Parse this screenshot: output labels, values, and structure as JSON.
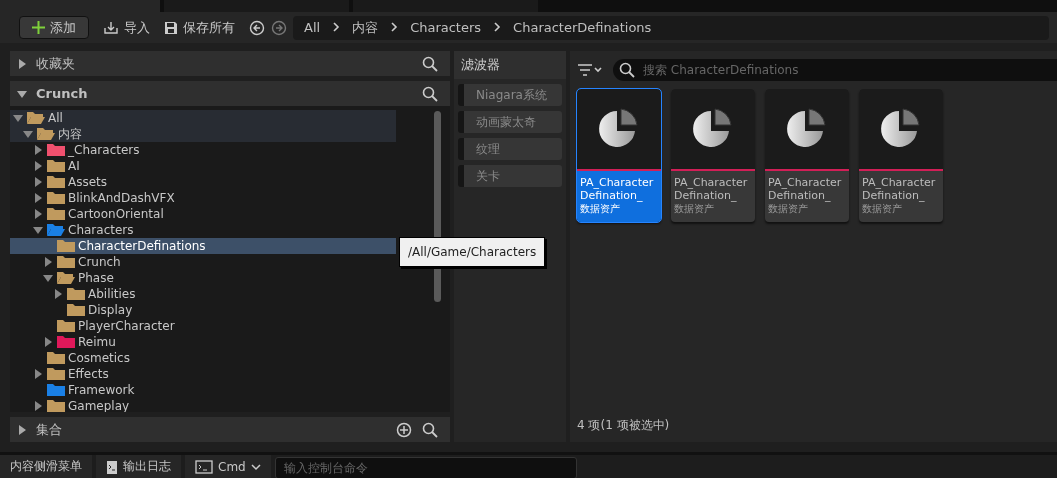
{
  "tabs": [
    {
      "selected": true
    },
    {
      "selected": false
    },
    {
      "selected": false
    }
  ],
  "toolbar": {
    "add": "添加",
    "import": "导入",
    "save_all": "保存所有"
  },
  "breadcrumb": [
    "All",
    "内容",
    "Characters",
    "CharacterDefinations"
  ],
  "favorites": {
    "title": "收藏夹",
    "expanded": false
  },
  "project": {
    "title": "Crunch",
    "expanded": true
  },
  "tree": [
    {
      "label": "All",
      "expanded": true,
      "selected": false,
      "color": "#c09a5e",
      "children": [
        {
          "label": "内容",
          "expanded": true,
          "selected": false,
          "color": "#c09a5e",
          "children": [
            {
              "label": "_Characters",
              "expanded": false,
              "selected": false,
              "color": "#f0506e"
            },
            {
              "label": "AI",
              "expanded": false,
              "selected": false,
              "color": "#c09a5e"
            },
            {
              "label": "Assets",
              "expanded": false,
              "selected": false,
              "color": "#c09a5e"
            },
            {
              "label": "BlinkAndDashVFX",
              "expanded": false,
              "selected": false,
              "color": "#c09a5e"
            },
            {
              "label": "CartoonOriental",
              "expanded": false,
              "selected": false,
              "color": "#c09a5e"
            },
            {
              "label": "Characters",
              "expanded": true,
              "selected": false,
              "color": "#1a80e6",
              "children": [
                {
                  "label": "CharacterDefinations",
                  "selected": true,
                  "color": "#c09a5e"
                },
                {
                  "label": "Crunch",
                  "expanded": false,
                  "selected": false,
                  "color": "#c09a5e"
                },
                {
                  "label": "Phase",
                  "expanded": true,
                  "selected": false,
                  "color": "#c09a5e",
                  "children": [
                    {
                      "label": "Abilities",
                      "expanded": false,
                      "selected": false,
                      "color": "#c09a5e"
                    },
                    {
                      "label": "Display",
                      "selected": false,
                      "color": "#c09a5e"
                    }
                  ]
                },
                {
                  "label": "PlayerCharacter",
                  "selected": false,
                  "color": "#c09a5e"
                },
                {
                  "label": "Reimu",
                  "expanded": false,
                  "selected": false,
                  "color": "#e0185a"
                }
              ]
            },
            {
              "label": "Cosmetics",
              "selected": false,
              "color": "#c09a5e"
            },
            {
              "label": "Effects",
              "expanded": false,
              "selected": false,
              "color": "#c09a5e"
            },
            {
              "label": "Framework",
              "selected": false,
              "color": "#1a80e6"
            },
            {
              "label": "Gameplay",
              "expanded": false,
              "selected": false,
              "color": "#c09a5e"
            }
          ]
        }
      ]
    }
  ],
  "tooltip": "/All/Game/Characters",
  "collections": {
    "title": "集合",
    "expanded": false
  },
  "filters": {
    "title": "滤波器",
    "items": [
      {
        "label": "Niagara系统",
        "checked": false
      },
      {
        "label": "动画蒙太奇",
        "checked": false
      },
      {
        "label": "纹理",
        "checked": false
      },
      {
        "label": "关卡",
        "checked": false
      }
    ]
  },
  "search": {
    "placeholder": "搜索 CharacterDefinations"
  },
  "assets": [
    {
      "name": "PA_Character Defination_",
      "type": "数据资产",
      "selected": true
    },
    {
      "name": "PA_Character Defination_",
      "type": "数据资产",
      "selected": false
    },
    {
      "name": "PA_Character Defination_",
      "type": "数据资产",
      "selected": false
    },
    {
      "name": "PA_Character Defination_",
      "type": "数据资产",
      "selected": false
    }
  ],
  "status": "4 项(1 项被选中)",
  "bottom_bar": {
    "drawer": "内容侧滑菜单",
    "output_log": "输出日志",
    "cmd": "Cmd",
    "console_placeholder": "输入控制台命令"
  }
}
